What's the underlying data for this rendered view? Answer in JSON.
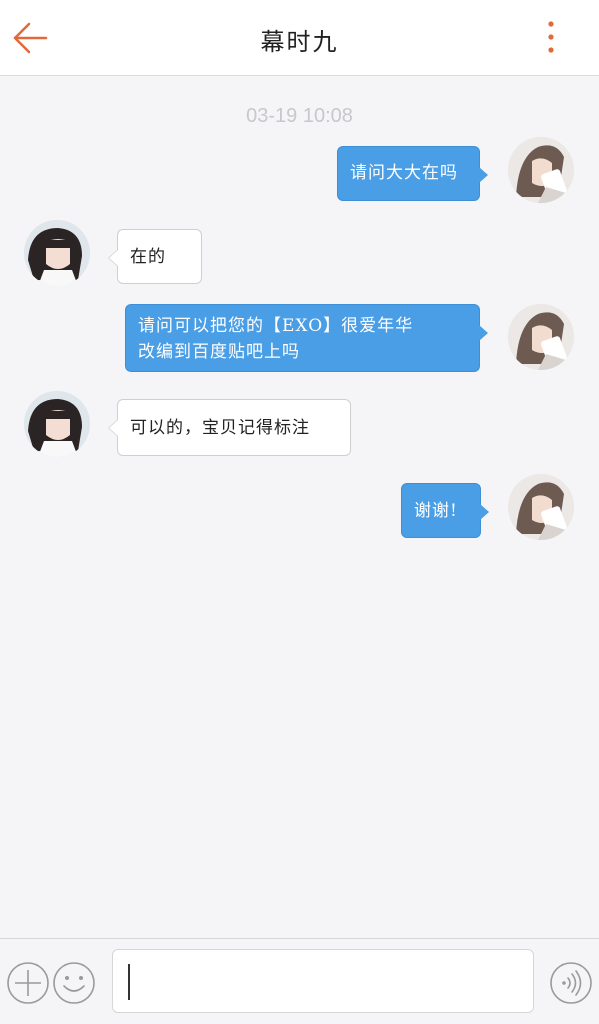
{
  "header": {
    "title": "幕时九",
    "back_icon": "arrow-left-icon",
    "more_icon": "more-vertical-icon",
    "accent_color": "#e06a3b"
  },
  "conversation": {
    "timestamp": "03-19 10:08",
    "messages": [
      {
        "direction": "out",
        "text": "请问大大在吗"
      },
      {
        "direction": "in",
        "text": "在的"
      },
      {
        "direction": "out",
        "line1": "请问可以把您的【EXO】很爱年华",
        "line2": "改编到百度贴吧上吗"
      },
      {
        "direction": "in",
        "text": "可以的，宝贝记得标注"
      },
      {
        "direction": "out",
        "text": "谢谢!"
      }
    ]
  },
  "input_bar": {
    "add_icon": "plus-circle-icon",
    "emoji_icon": "smiley-icon",
    "voice_icon": "voice-icon",
    "value": ""
  },
  "colors": {
    "outgoing_bubble": "#4a9ee6",
    "incoming_bubble": "#ffffff",
    "background": "#f5f5f7"
  }
}
